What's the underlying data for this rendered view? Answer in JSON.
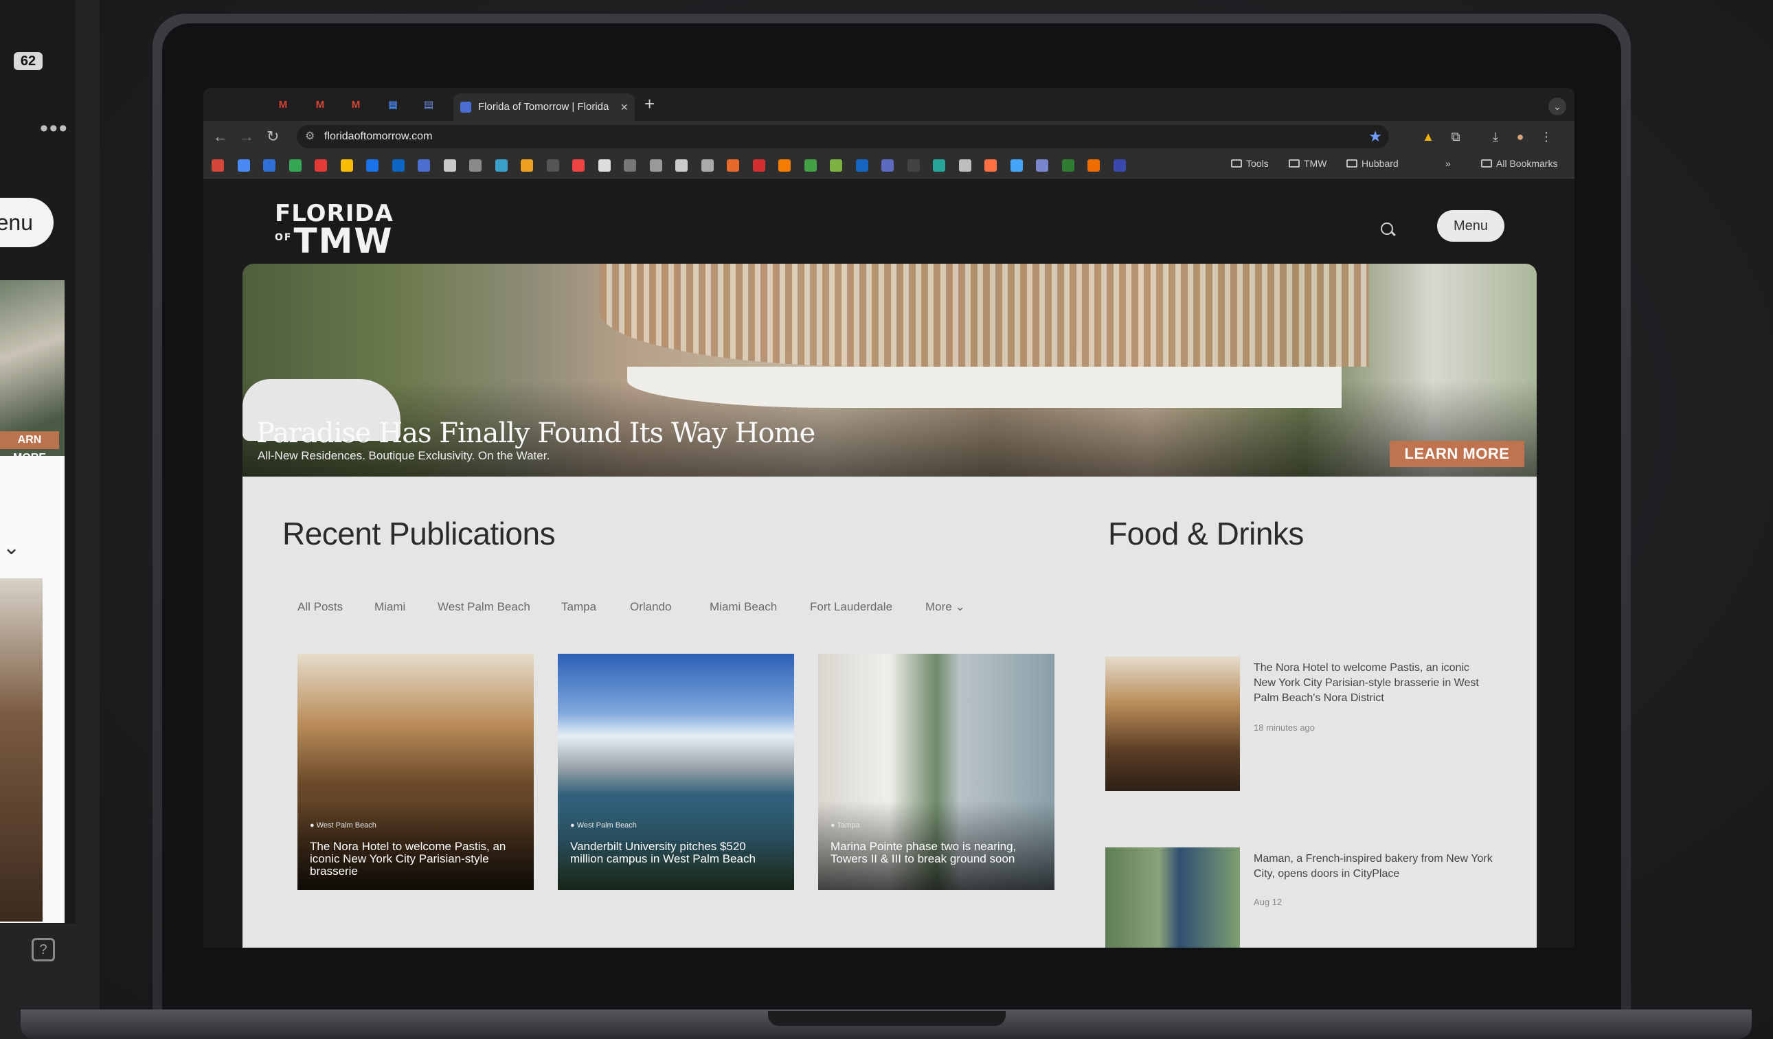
{
  "phone": {
    "battery": "62",
    "menu_label": "enu",
    "hero_button": "ARN MORE"
  },
  "browser": {
    "active_tab_title": "Florida of Tomorrow | Florida",
    "url": "floridaoftomorrow.com",
    "small_tabs": [
      "M",
      "M",
      "M",
      "▦",
      "▤"
    ],
    "bookmark_folders": [
      "Tools",
      "TMW",
      "Hubbard"
    ],
    "all_bookmarks": "All Bookmarks",
    "bookmark_colors": [
      "#d44638",
      "#4a8af4",
      "#2f6fd6",
      "#34a853",
      "#e53935",
      "#fbbc05",
      "#1a73e8",
      "#0a66c2",
      "#4a6fd0",
      "#c9c9c9",
      "#8a8a8a",
      "#3aa0c9",
      "#f0a020",
      "#555",
      "#e44",
      "#ddd",
      "#777",
      "#999",
      "#ccc",
      "#aaa",
      "#e66a2c",
      "#d32f2f",
      "#f57c00",
      "#43a047",
      "#7cb342",
      "#1565c0",
      "#5c6bc0",
      "#424242",
      "#26a69a",
      "#bdbdbd",
      "#ff7043",
      "#42a5f5",
      "#7986cb",
      "#2e7d32",
      "#ef6c00",
      "#3949ab"
    ]
  },
  "site": {
    "logo_top": "FLORIDA",
    "logo_of": "OF",
    "logo_bottom": "TMW",
    "menu_label": "Menu",
    "hero": {
      "title": "Paradise Has Finally Found Its Way Home",
      "subtitle": "All-New Residences. Boutique Exclusivity. On the Water.",
      "button": "LEARN MORE"
    },
    "recent": {
      "title": "Recent Publications",
      "filters": [
        "All Posts",
        "Miami",
        "West Palm Beach",
        "Tampa",
        "Orlando",
        "Miami Beach",
        "Fort Lauderdale",
        "More ⌄"
      ],
      "cards": [
        {
          "tag": "● West Palm Beach",
          "title": "The Nora Hotel to welcome Pastis, an iconic New York City Parisian-style brasserie"
        },
        {
          "tag": "● West Palm Beach",
          "title": "Vanderbilt University pitches $520 million campus in West Palm Beach"
        },
        {
          "tag": "● Tampa",
          "title": "Marina Pointe phase two is nearing, Towers II & III to break ground soon"
        }
      ]
    },
    "food": {
      "title": "Food & Drinks",
      "items": [
        {
          "title": "The Nora Hotel to welcome Pastis, an iconic New York City Parisian-style brasserie in West Palm Beach's Nora District",
          "time": "18 minutes ago"
        },
        {
          "title": "Maman, a French-inspired bakery from New York City, opens doors in CityPlace",
          "time": "Aug 12"
        }
      ]
    }
  }
}
